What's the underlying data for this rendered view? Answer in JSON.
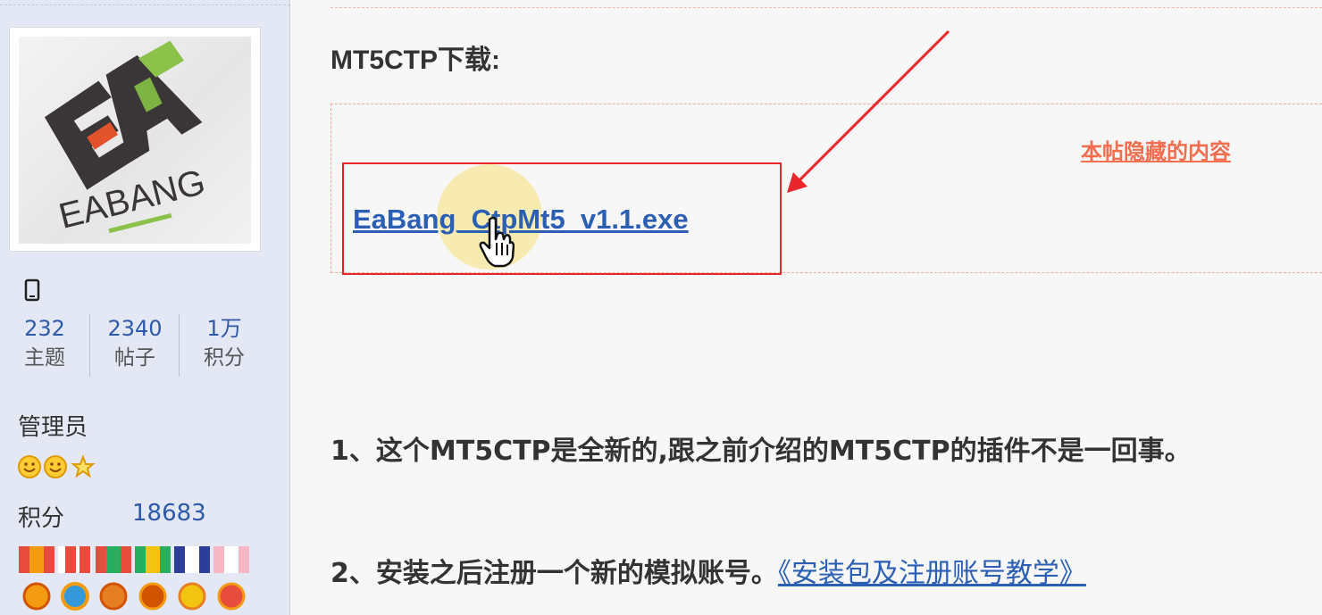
{
  "sidebar": {
    "stats": [
      {
        "value": "232",
        "label": "主题"
      },
      {
        "value": "2340",
        "label": "帖子"
      },
      {
        "value": "1万",
        "label": "积分"
      }
    ],
    "role": "管理员",
    "points_label": "积分",
    "points_value": "18683",
    "avatar_text": "EABANG",
    "icons": [
      "mobile-device-icon",
      "smiley-level-icon",
      "smiley-level-icon",
      "star-level-icon"
    ]
  },
  "content": {
    "download_title": "MT5CTP下载:",
    "hidden_label": "本帖隐藏的内容",
    "file_link": "EaBang_CtpMt5_v1.1.exe",
    "paragraph1": "1、这个MT5CTP是全新的,跟之前介绍的MT5CTP的插件不是一回事。",
    "paragraph2_prefix": "2、安装之后注册一个新的模拟账号。",
    "paragraph2_link": "《安装包及注册账号教学》"
  },
  "colors": {
    "link": "#2a5fb3",
    "highlight_border": "#e8262b",
    "hidden_label": "#f26e4e",
    "sidebar_bg": "#e4e7f4"
  }
}
